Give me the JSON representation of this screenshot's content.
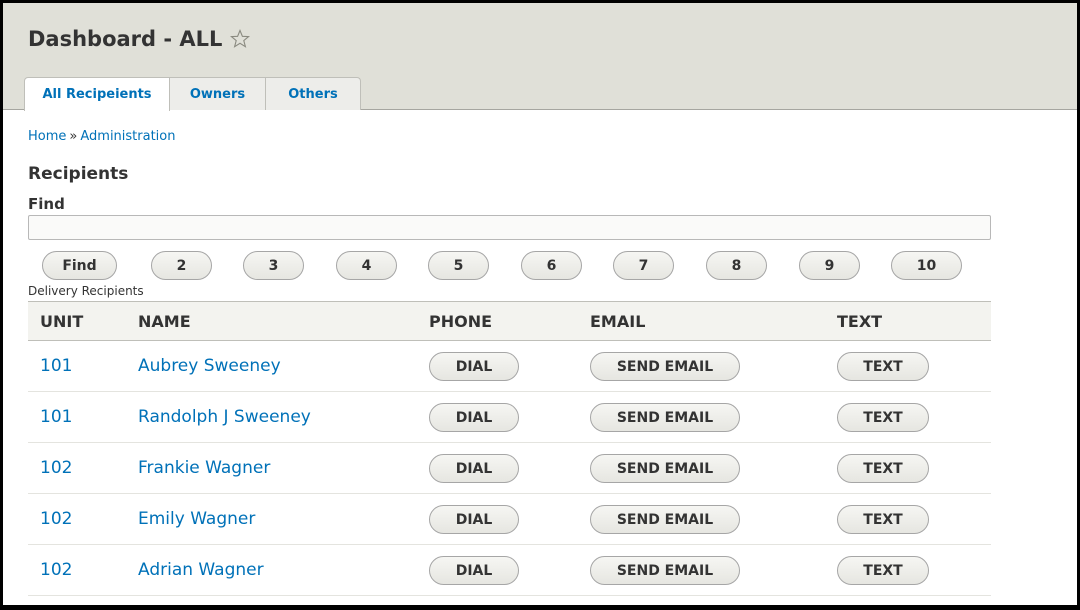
{
  "header": {
    "title": "Dashboard - ALL",
    "star_icon": "star-outline-icon"
  },
  "tabs": [
    {
      "label": "All Recipeients",
      "active": true
    },
    {
      "label": "Owners",
      "active": false
    },
    {
      "label": "Others",
      "active": false
    }
  ],
  "breadcrumb": {
    "items": [
      "Home",
      "Administration"
    ],
    "separator": "»"
  },
  "section_title": "Recipients",
  "find": {
    "label": "Find",
    "value": "",
    "placeholder": "",
    "button_label": "Find"
  },
  "pager": [
    "2",
    "3",
    "4",
    "5",
    "6",
    "7",
    "8",
    "9",
    "10"
  ],
  "table": {
    "caption": "Delivery Recipients",
    "columns": [
      "UNIT",
      "NAME",
      "PHONE",
      "EMAIL",
      "TEXT"
    ],
    "rows": [
      {
        "unit": "101",
        "name": "Aubrey Sweeney",
        "phone_action": "DIAL",
        "email_action": "SEND EMAIL",
        "text_action": "TEXT"
      },
      {
        "unit": "101",
        "name": "Randolph J Sweeney",
        "phone_action": "DIAL",
        "email_action": "SEND EMAIL",
        "text_action": "TEXT"
      },
      {
        "unit": "102",
        "name": "Frankie Wagner",
        "phone_action": "DIAL",
        "email_action": "SEND EMAIL",
        "text_action": "TEXT"
      },
      {
        "unit": "102",
        "name": "Emily Wagner",
        "phone_action": "DIAL",
        "email_action": "SEND EMAIL",
        "text_action": "TEXT"
      },
      {
        "unit": "102",
        "name": "Adrian Wagner",
        "phone_action": "DIAL",
        "email_action": "SEND EMAIL",
        "text_action": "TEXT"
      }
    ]
  },
  "colors": {
    "link": "#0071b8",
    "header_bg": "#e0e0d8",
    "text": "#333333"
  }
}
